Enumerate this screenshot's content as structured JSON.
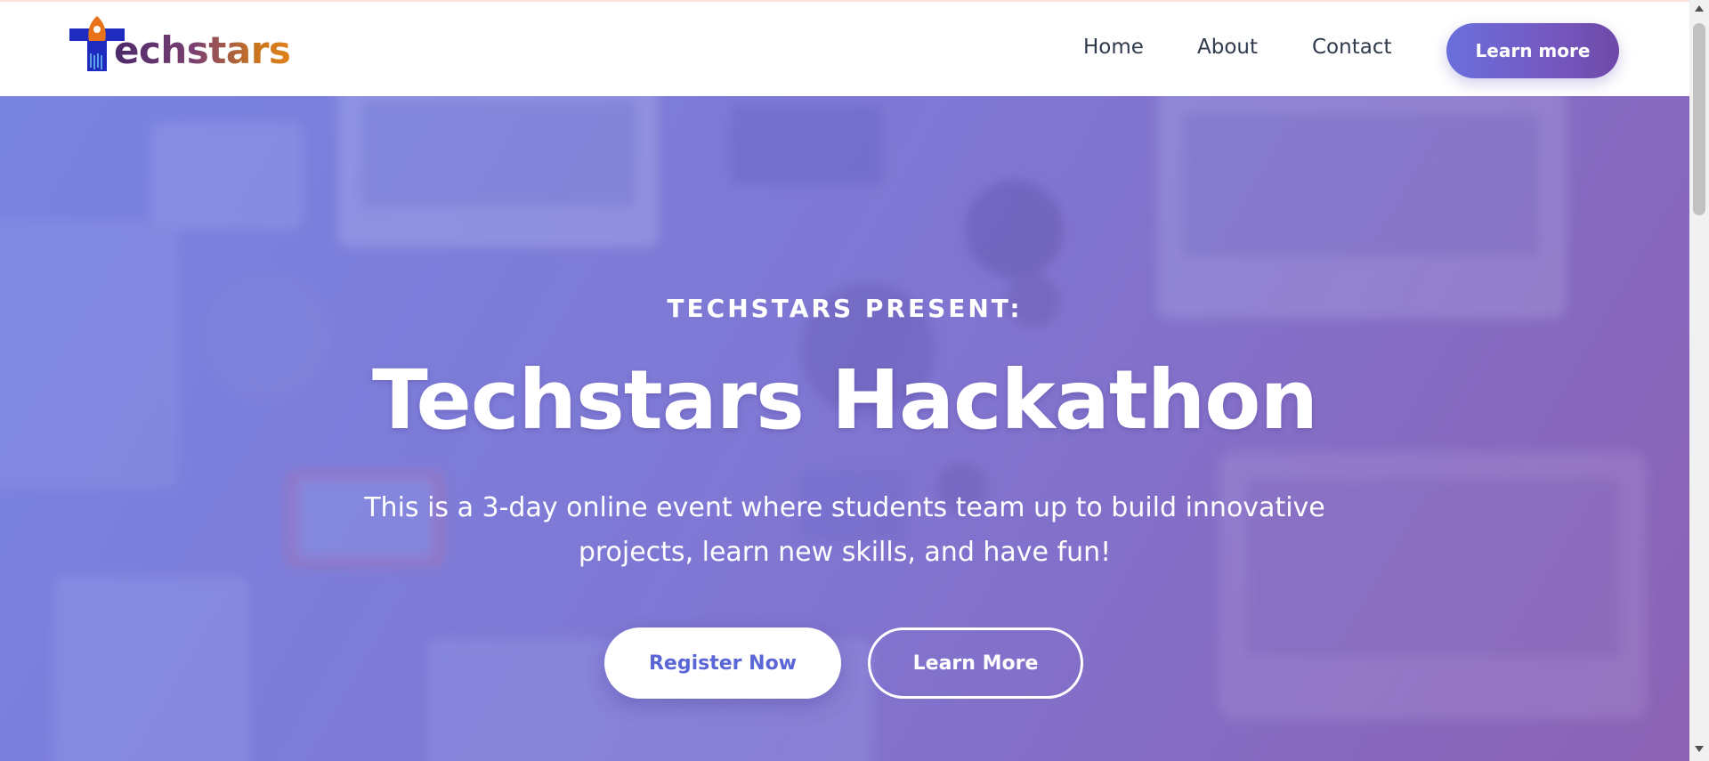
{
  "brand": {
    "name": "Techstars",
    "logo_icon": "rocket-t-icon",
    "logo_word": "echstars",
    "colors": {
      "navy": "#1f2bbf",
      "orange": "#e8731a",
      "purple": "#4b2a6a"
    }
  },
  "nav": {
    "items": [
      {
        "label": "Home"
      },
      {
        "label": "About"
      },
      {
        "label": "Contact"
      }
    ],
    "cta_label": "Learn more"
  },
  "hero": {
    "eyebrow": "TECHSTARS PRESENT:",
    "title": "Techstars Hackathon",
    "description": "This is a 3-day online event where students team up to build innovative projects, learn new skills, and have fun!",
    "primary_button": "Register Now",
    "secondary_button": "Learn More",
    "background": "blurred-desk-laptops-photo",
    "overlay_colors": [
      "#7b86dc",
      "#8a66b4"
    ]
  },
  "accent": {
    "button_gradient": [
      "#6a6fdc",
      "#6e4aa8"
    ]
  }
}
